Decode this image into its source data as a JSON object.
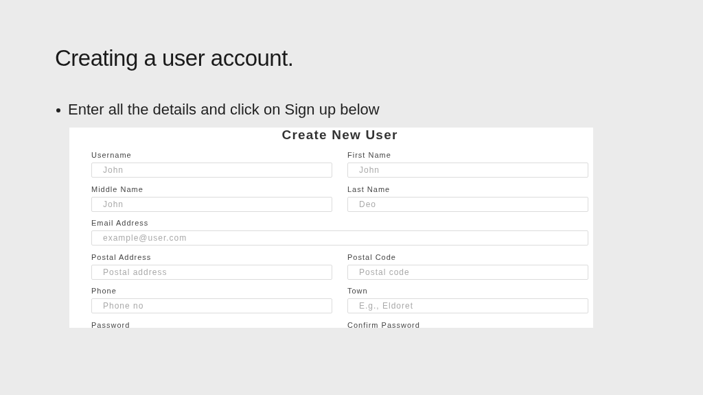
{
  "slide": {
    "title": "Creating a user account.",
    "bullets": [
      "Enter all the details and click on Sign up below"
    ]
  },
  "form": {
    "title": "Create New User",
    "rows": [
      [
        {
          "label": "Username",
          "placeholder": "John"
        },
        {
          "label": "First Name",
          "placeholder": "John"
        }
      ],
      [
        {
          "label": "Middle Name",
          "placeholder": "John"
        },
        {
          "label": "Last Name",
          "placeholder": "Deo"
        }
      ],
      [
        {
          "label": "Email Address",
          "placeholder": "example@user.com"
        }
      ],
      [
        {
          "label": "Postal Address",
          "placeholder": "Postal address"
        },
        {
          "label": "Postal Code",
          "placeholder": "Postal code"
        }
      ],
      [
        {
          "label": "Phone",
          "placeholder": "Phone no"
        },
        {
          "label": "Town",
          "placeholder": "E.g., Eldoret"
        }
      ],
      [
        {
          "label": "Password"
        },
        {
          "label": "Confirm Password"
        }
      ]
    ]
  }
}
